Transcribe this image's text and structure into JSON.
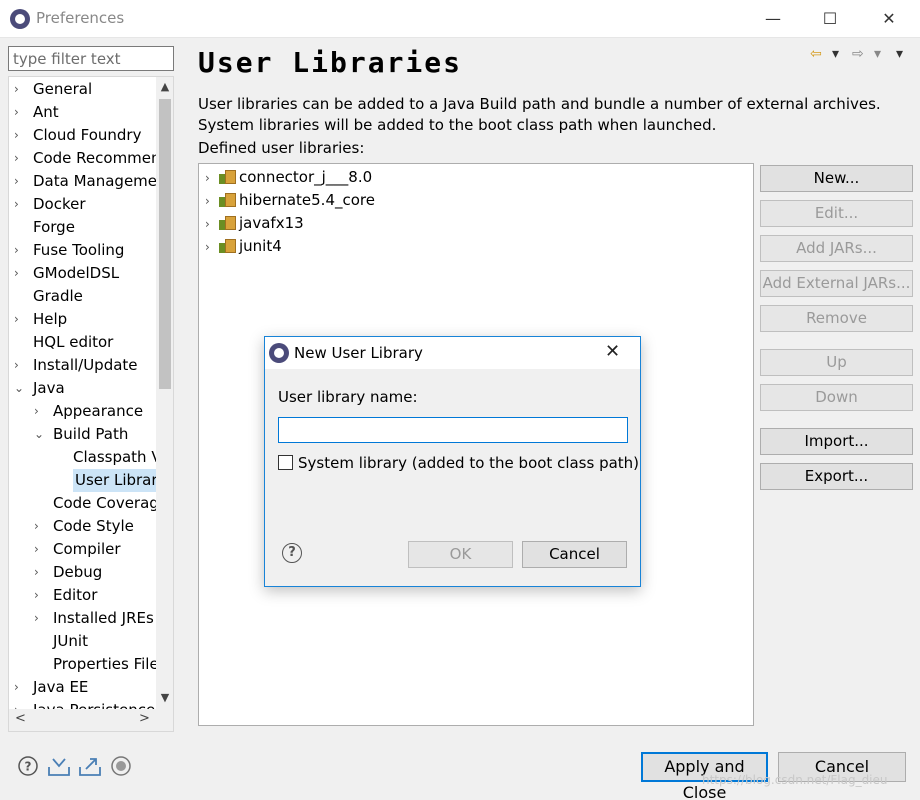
{
  "window": {
    "title": "Preferences",
    "controls": {
      "minimize": "—",
      "maximize": "☐",
      "close": "✕"
    }
  },
  "sidebar": {
    "filter_placeholder": "type filter text",
    "scroll": {
      "up": "▲",
      "down": "▼",
      "left": "<",
      "right": ">"
    },
    "items": [
      {
        "label": "General",
        "expander": "›",
        "level": 0
      },
      {
        "label": "Ant",
        "expander": "›",
        "level": 0
      },
      {
        "label": "Cloud Foundry",
        "expander": "›",
        "level": 0
      },
      {
        "label": "Code Recommenders",
        "expander": "›",
        "level": 0
      },
      {
        "label": "Data Management",
        "expander": "›",
        "level": 0
      },
      {
        "label": "Docker",
        "expander": "›",
        "level": 0
      },
      {
        "label": "Forge",
        "expander": "",
        "level": 0
      },
      {
        "label": "Fuse Tooling",
        "expander": "›",
        "level": 0
      },
      {
        "label": "GModelDSL",
        "expander": "›",
        "level": 0
      },
      {
        "label": "Gradle",
        "expander": "",
        "level": 0
      },
      {
        "label": "Help",
        "expander": "›",
        "level": 0
      },
      {
        "label": "HQL editor",
        "expander": "",
        "level": 0
      },
      {
        "label": "Install/Update",
        "expander": "›",
        "level": 0
      },
      {
        "label": "Java",
        "expander": "⌄",
        "level": 0
      },
      {
        "label": "Appearance",
        "expander": "›",
        "level": 1
      },
      {
        "label": "Build Path",
        "expander": "⌄",
        "level": 1
      },
      {
        "label": "Classpath Variables",
        "expander": "",
        "level": 2
      },
      {
        "label": "User Libraries",
        "expander": "",
        "level": 2,
        "selected": true
      },
      {
        "label": "Code Coverage",
        "expander": "",
        "level": 1
      },
      {
        "label": "Code Style",
        "expander": "›",
        "level": 1
      },
      {
        "label": "Compiler",
        "expander": "›",
        "level": 1
      },
      {
        "label": "Debug",
        "expander": "›",
        "level": 1
      },
      {
        "label": "Editor",
        "expander": "›",
        "level": 1
      },
      {
        "label": "Installed JREs",
        "expander": "›",
        "level": 1
      },
      {
        "label": "JUnit",
        "expander": "",
        "level": 1
      },
      {
        "label": "Properties Files Editor",
        "expander": "",
        "level": 1
      },
      {
        "label": "Java EE",
        "expander": "›",
        "level": 0
      },
      {
        "label": "Java Persistence",
        "expander": "›",
        "level": 0
      }
    ]
  },
  "main": {
    "title": "User Libraries",
    "nav": {
      "back": "⇦",
      "back_menu": "▾",
      "forward": "⇨",
      "forward_menu": "▾",
      "view_menu": "▾"
    },
    "description": "User libraries can be added to a Java Build path and bundle a number of external archives. System libraries will be added to the boot class path when launched.",
    "list_label": "Defined user libraries:",
    "libraries": [
      {
        "name": "connector_j___8.0",
        "expander": "›"
      },
      {
        "name": "hibernate5.4_core",
        "expander": "›"
      },
      {
        "name": "javafx13",
        "expander": "›"
      },
      {
        "name": "junit4",
        "expander": "›"
      }
    ],
    "buttons": {
      "new": "New...",
      "edit": "Edit...",
      "add_jars": "Add JARs...",
      "add_external_jars": "Add External JARs...",
      "remove": "Remove",
      "up": "Up",
      "down": "Down",
      "import": "Import...",
      "export": "Export..."
    }
  },
  "footer": {
    "apply_close": "Apply and Close",
    "cancel": "Cancel",
    "watermark": "https://blog.csdn.net/Flag_dieu"
  },
  "dialog": {
    "title": "New User Library",
    "close": "✕",
    "name_label": "User library name:",
    "name_value": "",
    "system_library_label": "System library (added to the boot class path)",
    "help": "?",
    "ok": "OK",
    "cancel": "Cancel"
  }
}
